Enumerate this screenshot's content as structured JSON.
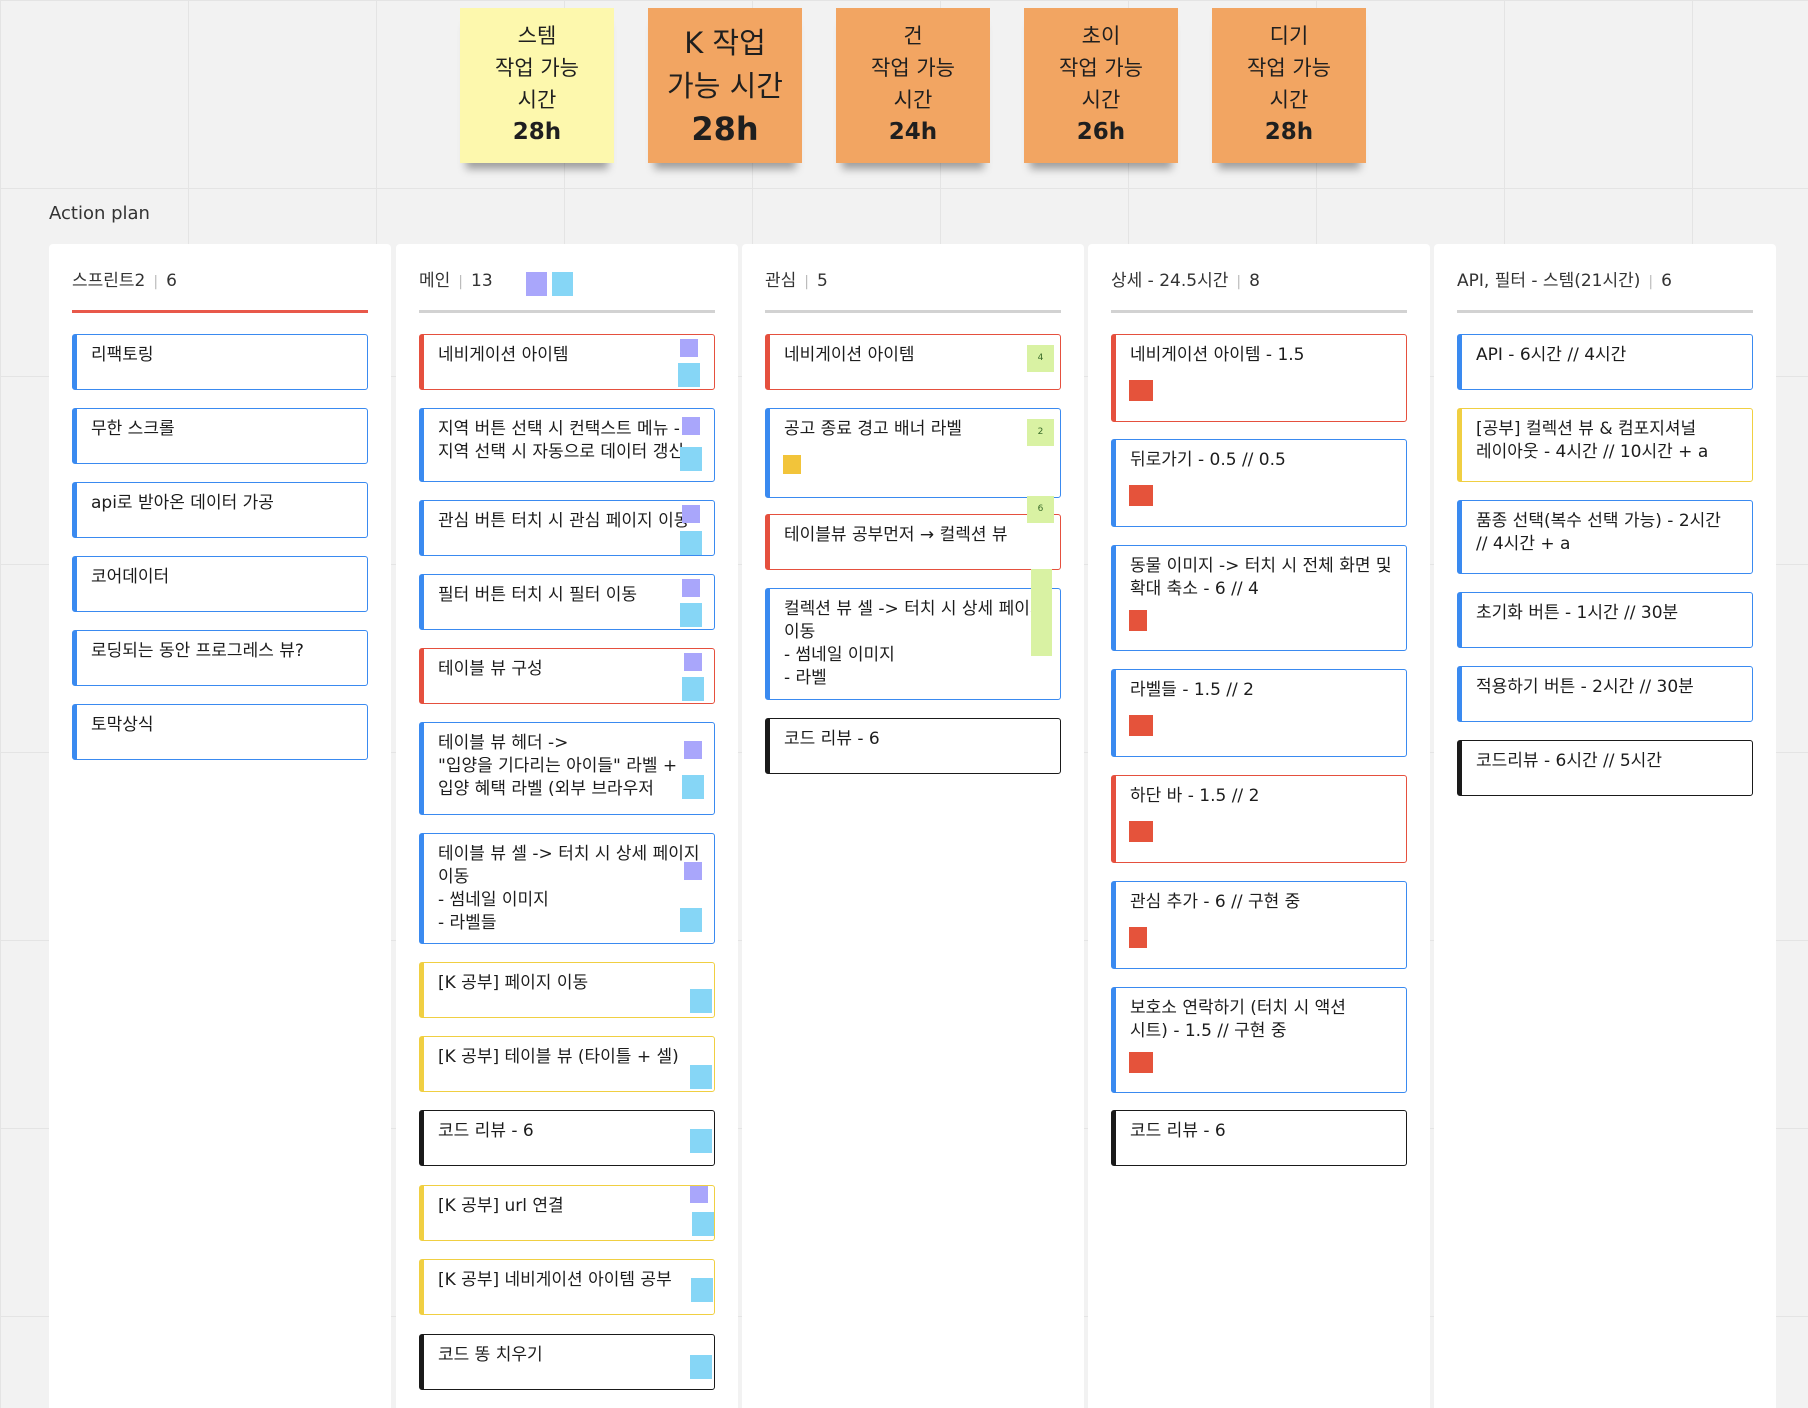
{
  "colors": {
    "sticky_yellow": "#fdf8ad",
    "sticky_orange": "#f2a562",
    "card_blue": "#3a8af0",
    "card_red": "#e5503e",
    "card_yellow": "#f0cf42",
    "card_black": "#1a1a1a",
    "tag_purple": "#a9a6fb",
    "tag_cyan": "#86d6f6",
    "tag_orange": "#e5533b",
    "tag_lime": "#d9f2a3"
  },
  "stickies": [
    {
      "name": "스템",
      "label": "작업 가능",
      "label2": "시간",
      "hours": "28h"
    },
    {
      "line1": "K 작업",
      "line2": "가능 시간",
      "hours": "28h"
    },
    {
      "name": "건",
      "label": "작업 가능",
      "label2": "시간",
      "hours": "24h"
    },
    {
      "name": "초이",
      "label": "작업 가능",
      "label2": "시간",
      "hours": "26h"
    },
    {
      "name": "디기",
      "label": "작업 가능",
      "label2": "시간",
      "hours": "28h"
    }
  ],
  "section_title": "Action plan",
  "columns": [
    {
      "title": "스프린트2",
      "count": "6",
      "cards": [
        {
          "lines": [
            "리팩토링"
          ]
        },
        {
          "lines": [
            "무한 스크롤"
          ]
        },
        {
          "lines": [
            "api로 받아온 데이터 가공"
          ]
        },
        {
          "lines": [
            "코어데이터"
          ]
        },
        {
          "lines": [
            "로딩되는 동안 프로그레스 뷰?"
          ]
        },
        {
          "lines": [
            "토막상식"
          ]
        }
      ]
    },
    {
      "title": "메인",
      "count": "13",
      "cards": [
        {
          "lines": [
            "네비게이션 아이템"
          ]
        },
        {
          "lines": [
            "지역 버튼 선택 시 컨택스트 메뉴 -",
            "지역 선택 시 자동으로 데이터 갱신"
          ]
        },
        {
          "lines": [
            "관심 버튼 터치 시 관심 페이지 이동"
          ]
        },
        {
          "lines": [
            "필터 버튼 터치 시 필터 이동"
          ]
        },
        {
          "lines": [
            "테이블 뷰 구성"
          ]
        },
        {
          "lines": [
            "테이블 뷰 헤더 ->",
            "\"입양을 기다리는 아이들\" 라벨 +",
            "입양 혜택 라벨 (외부 브라우저"
          ]
        },
        {
          "lines": [
            "테이블 뷰 셀 -> 터치 시 상세 페이지",
            "이동",
            "- 썸네일 이미지",
            "- 라벨들"
          ]
        },
        {
          "lines": [
            "[K 공부] 페이지 이동"
          ]
        },
        {
          "lines": [
            "[K 공부] 테이블 뷰 (타이틀 + 셀)"
          ]
        },
        {
          "lines": [
            "코드 리뷰 - 6"
          ]
        },
        {
          "lines": [
            "[K 공부] url 연결"
          ]
        },
        {
          "lines": [
            "[K 공부] 네비게이션 아이템 공부"
          ]
        },
        {
          "lines": [
            "코드 똥 치우기"
          ]
        }
      ]
    },
    {
      "title": "관심",
      "count": "5",
      "cards": [
        {
          "lines": [
            "네비게이션 아이템"
          ],
          "tag": "4"
        },
        {
          "lines": [
            "공고 종료 경고 배너 라벨"
          ],
          "tag": "2"
        },
        {
          "lines": [
            "테이블뷰 공부먼저  → 컬렉션 뷰"
          ],
          "tag": "6"
        },
        {
          "lines": [
            "컬렉션 뷰 셀 -> 터치 시 상세 페이지",
            "이동",
            "- 썸네일 이미지",
            "- 라벨"
          ]
        },
        {
          "lines": [
            "코드 리뷰 - 6"
          ]
        }
      ]
    },
    {
      "title": "상세 - 24.5시간",
      "count": "8",
      "cards": [
        {
          "lines": [
            "네비게이션 아이템 - 1.5"
          ]
        },
        {
          "lines": [
            "뒤로가기 - 0.5 // 0.5"
          ]
        },
        {
          "lines": [
            "동물 이미지 -> 터치 시 전체 화면 및",
            "확대 축소 - 6 // 4"
          ]
        },
        {
          "lines": [
            "라벨들 - 1.5 // 2"
          ]
        },
        {
          "lines": [
            "하단 바 - 1.5 // 2"
          ]
        },
        {
          "lines": [
            "관심 추가 - 6 // 구현 중"
          ]
        },
        {
          "lines": [
            "보호소 연락하기 (터치 시 액션",
            "시트) - 1.5 // 구현 중"
          ]
        },
        {
          "lines": [
            "코드 리뷰 - 6"
          ]
        }
      ]
    },
    {
      "title": "API, 필터 - 스템(21시간)",
      "count": "6",
      "cards": [
        {
          "lines": [
            "API - 6시간 // 4시간"
          ]
        },
        {
          "lines": [
            "[공부] 컬렉션 뷰 & 컴포지셔널",
            "레이아웃 - 4시간 // 10시간 + a"
          ]
        },
        {
          "lines": [
            "품종 선택(복수 선택 가능) - 2시간",
            "// 4시간 + a"
          ]
        },
        {
          "lines": [
            "초기화 버튼 - 1시간 // 30분"
          ]
        },
        {
          "lines": [
            "적용하기 버튼 - 2시간 // 30분"
          ]
        },
        {
          "lines": [
            "코드리뷰 - 6시간 // 5시간"
          ]
        }
      ]
    }
  ]
}
